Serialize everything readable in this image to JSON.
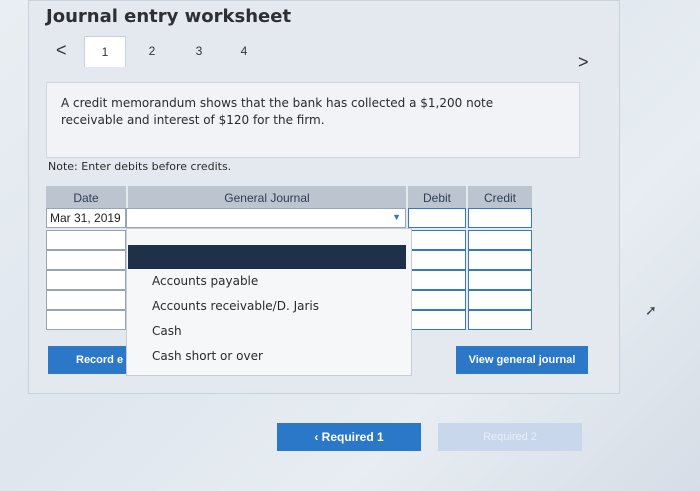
{
  "title": "Journal entry worksheet",
  "tabs": [
    "1",
    "2",
    "3",
    "4"
  ],
  "nav": {
    "prev": "<",
    "next": ">"
  },
  "prompt": "A credit memorandum shows that the bank has collected a $1,200 note receivable and interest of $120 for the firm.",
  "note": "Note: Enter debits before credits.",
  "table": {
    "headers": {
      "date": "Date",
      "journal": "General Journal",
      "debit": "Debit",
      "credit": "Credit"
    },
    "date_value": "Mar 31, 2019"
  },
  "dropdown": {
    "items": [
      "Accounts payable",
      "Accounts receivable/D. Jaris",
      "Cash",
      "Cash short or over"
    ]
  },
  "buttons": {
    "record": "Record e",
    "view": "View general journal",
    "required": "Required 1",
    "next": "Required 2"
  }
}
